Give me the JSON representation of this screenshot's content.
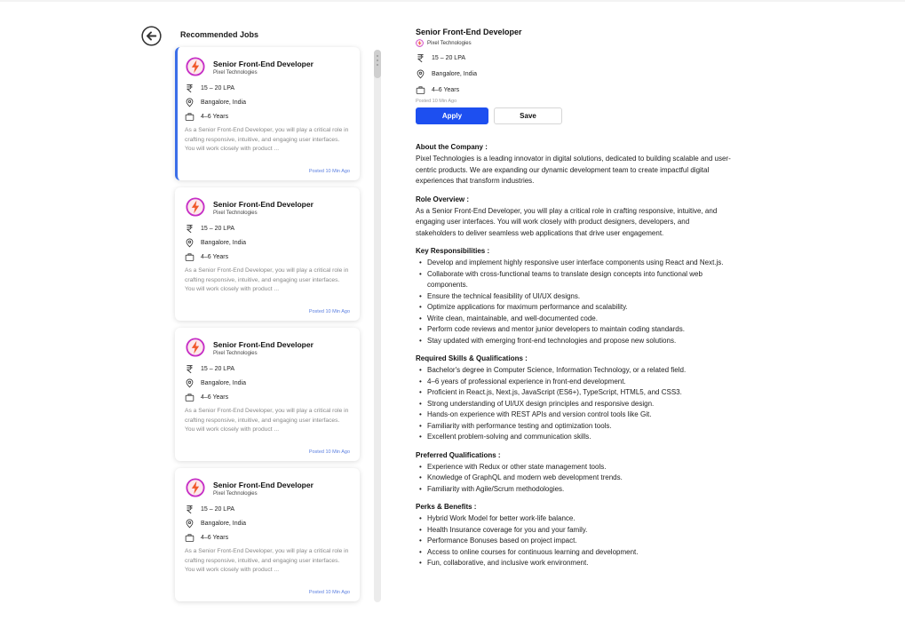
{
  "list": {
    "title": "Recommended Jobs",
    "jobs": [
      {
        "title": "Senior Front-End Developer",
        "company": "Pixel Technologies",
        "salary": "15 – 20 LPA",
        "location": "Bangalore, India",
        "experience": "4–6 Years",
        "description": "As a Senior Front-End Developer, you will play a critical role in crafting responsive, intuitive, and engaging user interfaces. You will work closely with product ...",
        "posted": "Posted 10 Min Ago",
        "selected": true
      },
      {
        "title": "Senior Front-End Developer",
        "company": "Pixel Technologies",
        "salary": "15 – 20 LPA",
        "location": "Bangalore, India",
        "experience": "4–6 Years",
        "description": "As a Senior Front-End Developer, you will play a critical role in crafting responsive, intuitive, and engaging user interfaces. You will work closely with product ...",
        "posted": "Posted 10 Min Ago",
        "selected": false
      },
      {
        "title": "Senior Front-End Developer",
        "company": "Pixel Technologies",
        "salary": "15 – 20 LPA",
        "location": "Bangalore, India",
        "experience": "4–6 Years",
        "description": "As a Senior Front-End Developer, you will play a critical role in crafting responsive, intuitive, and engaging user interfaces. You will work closely with product ...",
        "posted": "Posted 10 Min Ago",
        "selected": false
      },
      {
        "title": "Senior Front-End Developer",
        "company": "Pixel Technologies",
        "salary": "15 – 20 LPA",
        "location": "Bangalore, India",
        "experience": "4–6 Years",
        "description": "As a Senior Front-End Developer, you will play a critical role in crafting responsive, intuitive, and engaging user interfaces. You will work closely with product ...",
        "posted": "Posted 10 Min Ago",
        "selected": false
      }
    ]
  },
  "detail": {
    "title": "Senior Front-End Developer",
    "company": "Pixel Technologies",
    "salary": "15 – 20 LPA",
    "location": "Bangalore, India",
    "experience": "4–6 Years",
    "posted": "Posted 10 Min Ago",
    "apply_label": "Apply",
    "save_label": "Save",
    "about_heading": "About the Company :",
    "about_text": "Pixel Technologies is a leading innovator in digital solutions, dedicated to building scalable and user-centric products. We are expanding our dynamic development team to create impactful digital experiences that transform industries.",
    "role_heading": "Role Overview :",
    "role_text": "As a Senior Front-End Developer, you will play a critical role in crafting responsive, intuitive, and engaging user interfaces. You will work closely with product designers, developers, and stakeholders to deliver seamless web applications that drive user engagement.",
    "sections": [
      {
        "heading": "Key Responsibilities :",
        "items": [
          "Develop and implement highly responsive user interface components using React and Next.js.",
          "Collaborate with cross-functional teams to translate design concepts into functional web components.",
          "Ensure the technical feasibility of UI/UX designs.",
          "Optimize applications for maximum performance and scalability.",
          "Write clean, maintainable, and well-documented code.",
          "Perform code reviews and mentor junior developers to maintain coding standards.",
          "Stay updated with emerging front-end technologies and propose new solutions."
        ]
      },
      {
        "heading": "Required Skills & Qualifications :",
        "items": [
          "Bachelor's degree in Computer Science, Information Technology, or a related field.",
          "4–6 years of professional experience in front-end development.",
          "Proficient in React.js, Next.js, JavaScript (ES6+), TypeScript, HTML5, and CSS3.",
          "Strong understanding of UI/UX design principles and responsive design.",
          "Hands-on experience with REST APIs and version control tools like Git.",
          "Familiarity with performance testing and optimization tools.",
          "Excellent problem-solving and communication skills."
        ]
      },
      {
        "heading": "Preferred Qualifications :",
        "items": [
          "Experience with Redux or other state management tools.",
          "Knowledge of GraphQL and modern web development trends.",
          "Familiarity with Agile/Scrum methodologies."
        ]
      },
      {
        "heading": "Perks & Benefits :",
        "items": [
          "Hybrid Work Model for better work-life balance.",
          "Health Insurance coverage for you and your family.",
          "Performance Bonuses based on project impact.",
          "Access to online courses for continuous learning and development.",
          "Fun, collaborative, and inclusive work environment."
        ]
      }
    ]
  },
  "icons": {
    "back": "back-arrow-icon",
    "logo": "lightning-logo-icon",
    "salary": "rupee-icon",
    "location": "location-pin-icon",
    "experience": "briefcase-icon"
  },
  "colors": {
    "accent": "#1d4ff0",
    "selected_border": "#3b6ee8",
    "posted_link": "#5b7fe0",
    "logo_magenta": "#c62ec6",
    "logo_orange": "#f0582a"
  }
}
